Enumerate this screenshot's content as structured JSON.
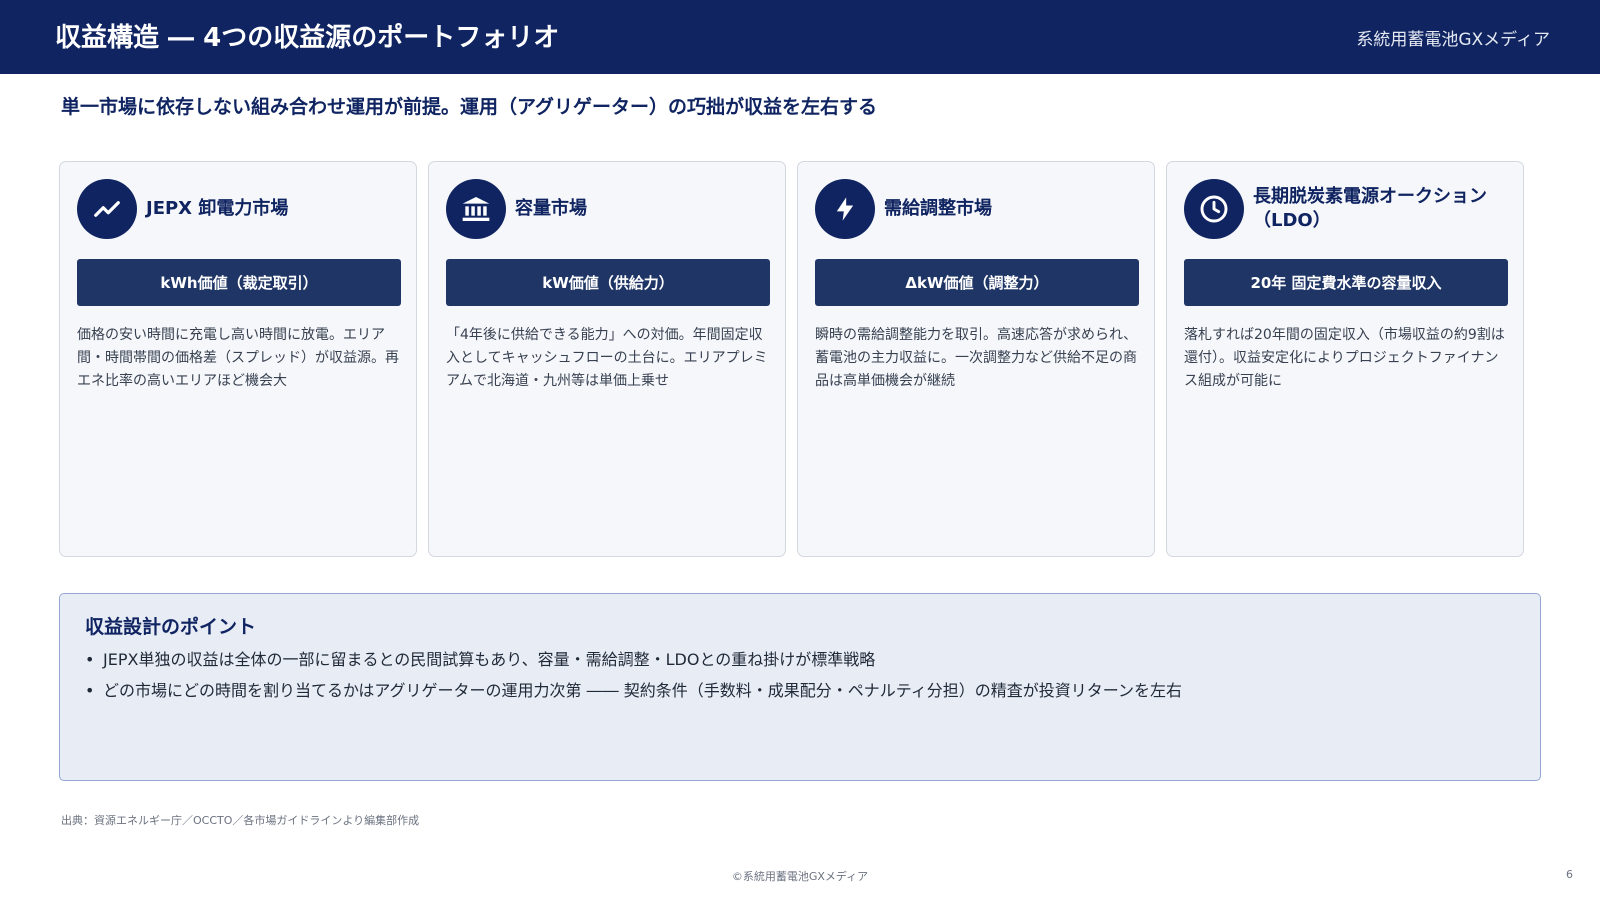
{
  "header": {
    "title": "収益構造 ― 4つの収益源のポートフォリオ",
    "brand": "系統用蓄電池GXメディア"
  },
  "lead": "単一市場に依存しない組み合わせ運用が前提。運用（アグリゲーター）の巧拙が収益を左右する",
  "cards": [
    {
      "icon": "trend-up-icon",
      "title": "JEPX 卸電力市場",
      "pill": "kWh価値（裁定取引）",
      "body": "価格の安い時間に充電し高い時間に放電。エリア間・時間帯間の価格差（スプレッド）が収益源。再エネ比率の高いエリアほど機会大"
    },
    {
      "icon": "bank-icon",
      "title": "容量市場",
      "pill": "kW価値（供給力）",
      "body": "「4年後に供給できる能力」への対価。年間固定収入としてキャッシュフローの土台に。エリアプレミアムで北海道・九州等は単価上乗せ"
    },
    {
      "icon": "bolt-icon",
      "title": "需給調整市場",
      "pill": "ΔkW価値（調整力）",
      "body": "瞬時の需給調整能力を取引。高速応答が求められ、蓄電池の主力収益に。一次調整力など供給不足の商品は高単価機会が継続"
    },
    {
      "icon": "clock-icon",
      "title": "長期脱炭素電源オークション（LDO）",
      "pill": "20年 固定費水準の容量収入",
      "body": "落札すれば20年間の固定収入（市場収益の約9割は還付）。収益安定化によりプロジェクトファイナンス組成が可能に"
    }
  ],
  "points": {
    "title": "収益設計のポイント",
    "items": [
      "JEPX単独の収益は全体の一部に留まるとの民間試算もあり、容量・需給調整・LDOとの重ね掛けが標準戦略",
      "どの市場にどの時間を割り当てるかはアグリゲーターの運用力次第 ―― 契約条件（手数料・成果配分・ペナルティ分担）の精査が投資リターンを左右"
    ]
  },
  "source": "出典：資源エネルギー庁／OCCTO／各市場ガイドラインより編集部作成",
  "copyright": "©系統用蓄電池GXメディア",
  "page_number": "6"
}
